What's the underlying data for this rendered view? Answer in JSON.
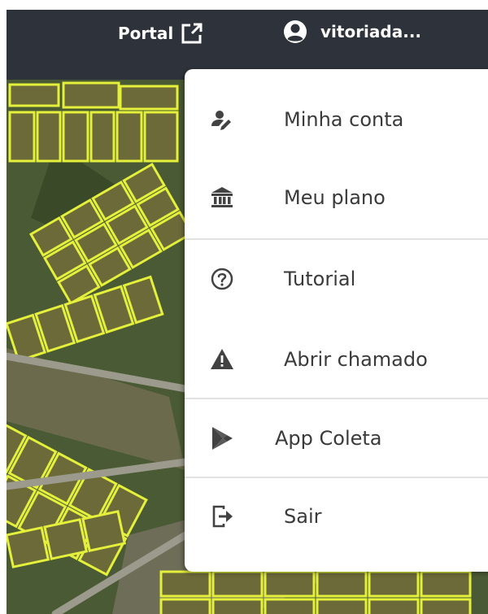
{
  "header": {
    "portal_label": "Portal",
    "username": "vitoriada..."
  },
  "menu": {
    "items": [
      {
        "label": "Minha conta",
        "icon": "user-edit-icon"
      },
      {
        "label": "Meu plano",
        "icon": "bank-icon"
      },
      {
        "label": "Tutorial",
        "icon": "help-circle-icon"
      },
      {
        "label": "Abrir chamado",
        "icon": "warning-icon"
      },
      {
        "label": "App Coleta",
        "icon": "play-store-icon"
      },
      {
        "label": "Sair",
        "icon": "logout-icon"
      }
    ]
  },
  "colors": {
    "header_bg": "#2e333b",
    "parcel_outline": "#e4f03a",
    "icon": "#424242",
    "menu_text": "#3a3a3a"
  }
}
